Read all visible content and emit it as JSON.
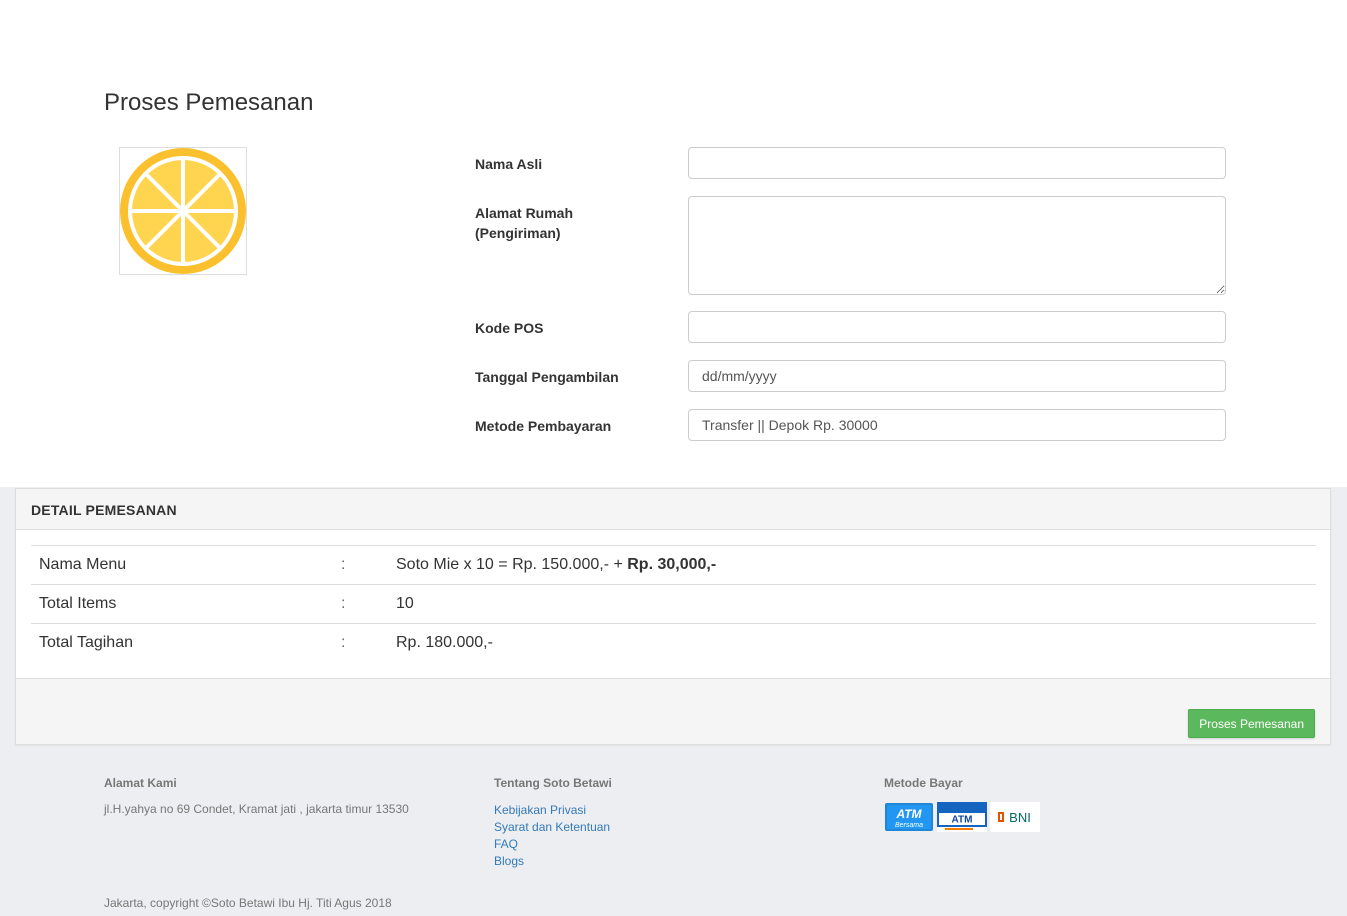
{
  "page": {
    "title": "Proses Pemesanan"
  },
  "form": {
    "nama_label": "Nama Asli",
    "alamat_label_line1": "Alamat Rumah",
    "alamat_label_line2": "(Pengiriman)",
    "kodepos_label": "Kode POS",
    "tanggal_label": "Tanggal Pengambilan",
    "tanggal_placeholder": "dd/mm/yyyy",
    "metode_label": "Metode Pembayaran",
    "metode_value": "Transfer || Depok Rp. 30000"
  },
  "detail": {
    "title": "DETAIL PEMESANAN",
    "rows": [
      {
        "label": "Nama Menu",
        "colon": ":",
        "value": "Soto Mie x 10 = Rp. 150.000,- + ",
        "value_bold": "Rp. 30,000,-"
      },
      {
        "label": "Total Items",
        "colon": ":",
        "value": "10"
      },
      {
        "label": "Total Tagihan",
        "colon": ":",
        "value": "Rp. 180.000,-"
      }
    ],
    "submit_label": "Proses Pemesanan"
  },
  "footer": {
    "alamat_heading": "Alamat Kami",
    "alamat_text": "jl.H.yahya no 69 Condet, Kramat jati , jakarta timur 13530",
    "tentang_heading": "Tentang Soto Betawi",
    "links": [
      "Kebijakan Privasi",
      "Syarat dan Ketentuan",
      "FAQ",
      "Blogs"
    ],
    "metode_heading": "Metode Bayar",
    "pay_logos": {
      "atm_bersama_line1": "ATM",
      "atm_bersama_line2": "Bersama",
      "atm_bri_label": "ATM",
      "bni_label": "BNI"
    },
    "copyright": "Jakarta, copyright ©Soto Betawi Ibu Hj. Titi Agus 2018"
  },
  "colors": {
    "accent_button": "#5cb85c",
    "link": "#337ab7",
    "logo_yellow": "#fbc02d"
  }
}
